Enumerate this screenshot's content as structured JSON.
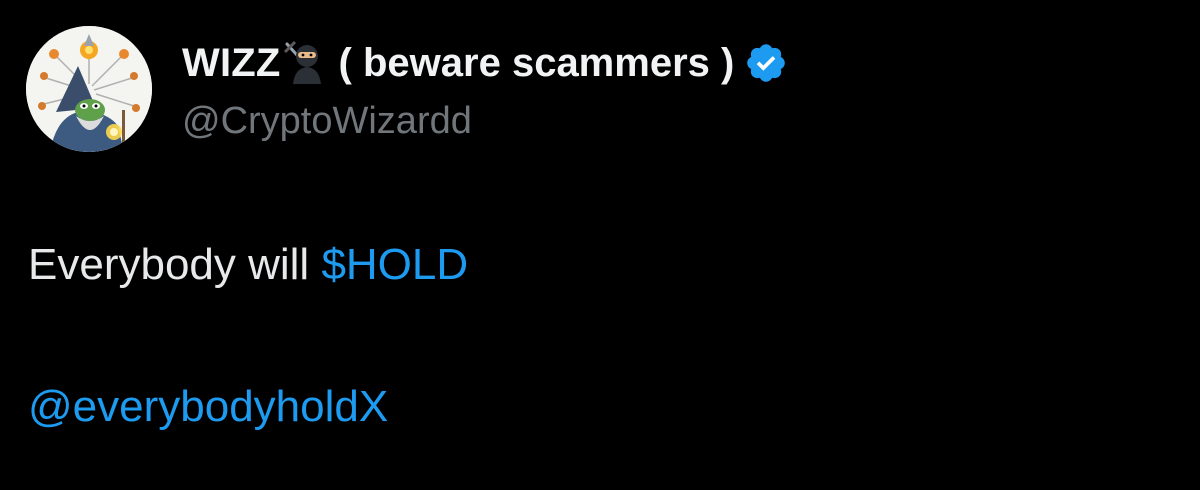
{
  "author": {
    "display_name": "WIZZ",
    "display_name_suffix": "( beware scammers )",
    "handle": "@CryptoWizardd",
    "avatar_icon": "wizard-avatar",
    "name_emoji_icon": "ninja-icon",
    "verified_icon": "verified-badge-icon",
    "verified_color": "#1d9bf0"
  },
  "tweet": {
    "text_prefix": "Everybody will ",
    "cashtag": "$HOLD",
    "mention": "@everybodyholdX"
  },
  "colors": {
    "background": "#000000",
    "text": "#e7e9ea",
    "secondary_text": "#71767b",
    "link": "#1d9bf0"
  }
}
